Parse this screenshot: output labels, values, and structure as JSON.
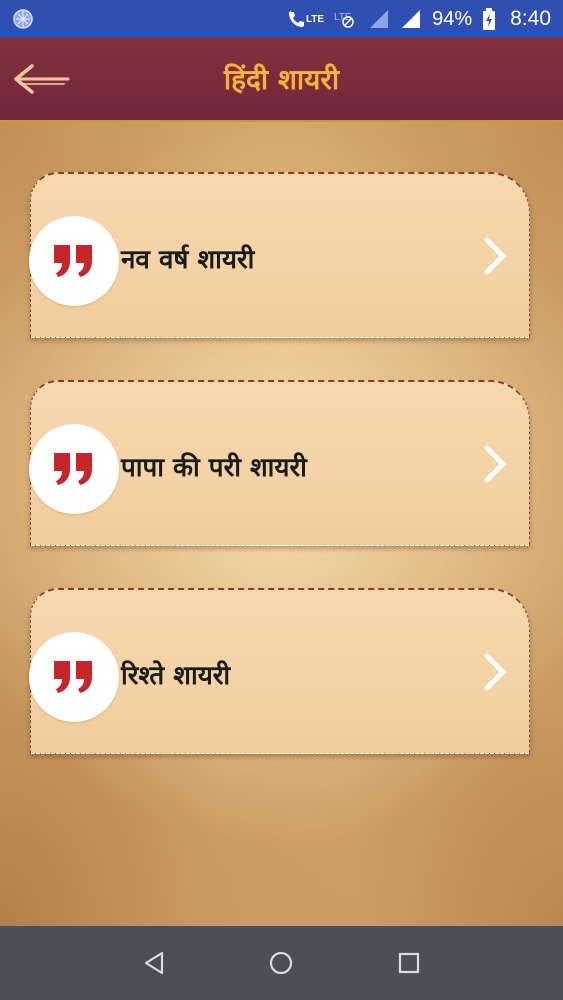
{
  "status_bar": {
    "battery_percent": "94%",
    "time": "8:40",
    "network_label": "LTE"
  },
  "app_bar": {
    "title": "हिंदी शायरी"
  },
  "list": {
    "items": [
      {
        "label": "नव वर्ष शायरी"
      },
      {
        "label": "पापा की परी शायरी"
      },
      {
        "label": "रिश्ते शायरी"
      }
    ]
  },
  "colors": {
    "status_bar": "#2f4fb3",
    "app_bar": "#7a2a3a",
    "title": "#f7b33c",
    "quote_mark": "#c4262b",
    "nav_bar": "#4a4f5a"
  },
  "icons": {
    "back": "back-arrow-icon",
    "quote": "quote-icon",
    "chevron": "chevron-right-icon",
    "nav_back": "nav-back-icon",
    "nav_home": "nav-home-icon",
    "nav_recents": "nav-recents-icon"
  }
}
